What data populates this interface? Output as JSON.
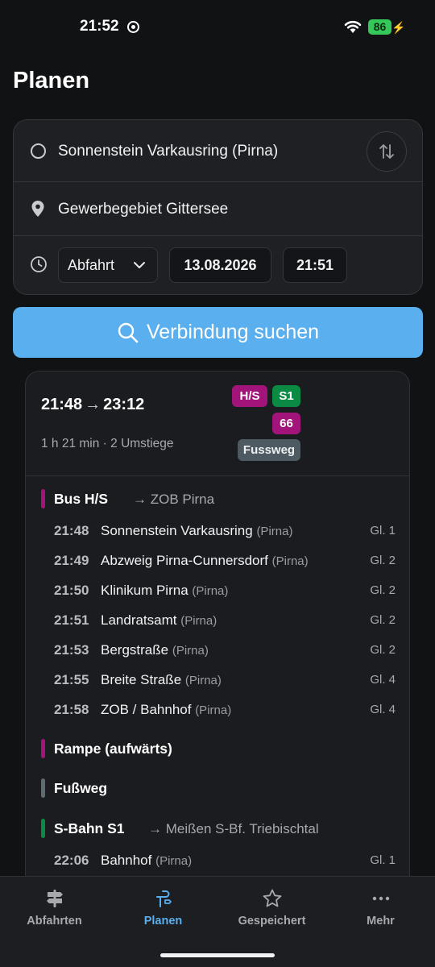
{
  "status_bar": {
    "time": "21:52",
    "battery": "86"
  },
  "page": {
    "title": "Planen"
  },
  "form": {
    "from": "Sonnenstein Varkausring (Pirna)",
    "to": "Gewerbegebiet Gittersee",
    "mode": "Abfahrt",
    "date": "13.08.2026",
    "time": "21:51"
  },
  "search": {
    "label": "Verbindung suchen"
  },
  "result": {
    "departure": "21:48",
    "arrow": "→",
    "arrival": "23:12",
    "summary": "1 h 21 min · 2 Umstiege",
    "badges": {
      "bus": "H/S",
      "sbahn": "S1",
      "bus2": "66",
      "walk": "Fussweg"
    },
    "legs": [
      {
        "title": "Bus H/S",
        "dest": "→ ZOB Pirna",
        "color": "#a3147a",
        "stops": [
          {
            "time": "21:48",
            "name": "Sonnenstein Varkausring",
            "city": "(Pirna)",
            "platform": "Gl. 1"
          },
          {
            "time": "21:49",
            "name": "Abzweig Pirna-Cunnersdorf",
            "city": "(Pirna)",
            "platform": "Gl. 2"
          },
          {
            "time": "21:50",
            "name": "Klinikum Pirna",
            "city": "(Pirna)",
            "platform": "Gl. 2"
          },
          {
            "time": "21:51",
            "name": "Landratsamt",
            "city": "(Pirna)",
            "platform": "Gl. 2"
          },
          {
            "time": "21:53",
            "name": "Bergstraße",
            "city": "(Pirna)",
            "platform": "Gl. 2"
          },
          {
            "time": "21:55",
            "name": "Breite Straße",
            "city": "(Pirna)",
            "platform": "Gl. 4"
          },
          {
            "time": "21:58",
            "name": "ZOB / Bahnhof",
            "city": "(Pirna)",
            "platform": "Gl. 4"
          }
        ]
      },
      {
        "title": "Rampe (aufwärts)",
        "dest": "",
        "color": "#a3147a",
        "stops": []
      },
      {
        "title": "Fußweg",
        "dest": "",
        "color": "#5d6a72",
        "stops": []
      },
      {
        "title": "S-Bahn S1",
        "dest": "→ Meißen S-Bf. Triebischtal",
        "color": "#0b8a44",
        "stops": [
          {
            "time": "22:06",
            "name": "Bahnhof",
            "city": "(Pirna)",
            "platform": "Gl. 1"
          }
        ]
      }
    ]
  },
  "tabs": [
    {
      "label": "Abfahrten",
      "icon": "signpost-icon",
      "active": false
    },
    {
      "label": "Planen",
      "icon": "route-icon",
      "active": true
    },
    {
      "label": "Gespeichert",
      "icon": "star-icon",
      "active": false
    },
    {
      "label": "Mehr",
      "icon": "more-icon",
      "active": false
    }
  ],
  "colors": {
    "accent": "#5aafee",
    "bus": "#a3147a",
    "sbahn": "#0b8a44",
    "walk": "#4e5a62"
  }
}
